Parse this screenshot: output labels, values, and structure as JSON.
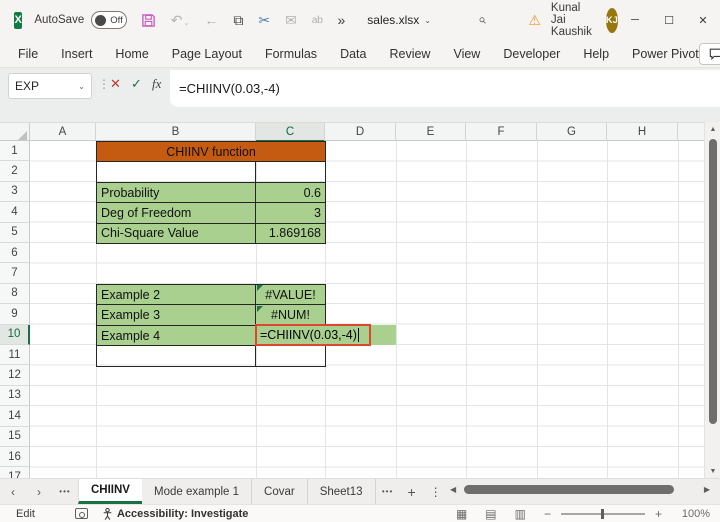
{
  "titlebar": {
    "app_initial": "X",
    "autosave_label": "AutoSave",
    "autosave_state": "Off",
    "doc_title": "sales.xlsx",
    "user_name": "Kunal Jai Kaushik",
    "user_initials": "KJ"
  },
  "icons": {
    "undo": "↶",
    "back": "←",
    "copy": "⧉",
    "cut": "✂",
    "mail": "✉",
    "replace": "ab",
    "overflow": "»",
    "chevron_down": "⌄",
    "warning": "⚠",
    "minimize": "─",
    "maximize": "☐",
    "close": "✕",
    "cancel": "✕",
    "enter": "✓",
    "dots_vertical": "⋮",
    "nav_left": "‹",
    "nav_right": "›",
    "tab_overflow": "•••",
    "add_sheet": "+",
    "scroll_up": "▲",
    "scroll_down": "▼",
    "scroll_left": "◀",
    "scroll_right": "▶",
    "view_normal": "▦",
    "view_layout": "▤",
    "view_break": "▥"
  },
  "ribbon": {
    "tabs": [
      "File",
      "Insert",
      "Home",
      "Page Layout",
      "Formulas",
      "Data",
      "Review",
      "View",
      "Developer",
      "Help",
      "Power Pivot"
    ],
    "comments_label": "Comments"
  },
  "formula_bar": {
    "name_box": "EXP",
    "fx_label": "fx",
    "formula": "=CHIINV(0.03,-4)"
  },
  "grid": {
    "col_headers": [
      "A",
      "B",
      "C",
      "D",
      "E",
      "F",
      "G",
      "H"
    ],
    "row_headers": [
      "1",
      "2",
      "3",
      "4",
      "5",
      "6",
      "7",
      "8",
      "9",
      "10",
      "11",
      "12",
      "13",
      "14",
      "15",
      "16",
      "17"
    ],
    "active_col": "C",
    "active_row": "10",
    "title_cell": "CHIINV function",
    "table1": [
      {
        "label": "Probability",
        "value": "0.6"
      },
      {
        "label": "Deg of Freedom",
        "value": "3"
      },
      {
        "label": "Chi-Square Value",
        "value": "1.869168"
      }
    ],
    "table2": [
      {
        "label": "Example 2",
        "value": "#VALUE!"
      },
      {
        "label": "Example 3",
        "value": "#NUM!"
      },
      {
        "label": "Example 4",
        "value": "=CHIINV(0.03,-4)"
      },
      {
        "label": "",
        "value": ""
      }
    ]
  },
  "sheet_tabs": {
    "tabs": [
      {
        "label": "CHIINV",
        "active": true
      },
      {
        "label": "Mode example 1",
        "active": false
      },
      {
        "label": "Covar",
        "active": false
      },
      {
        "label": "Sheet13",
        "active": false
      }
    ]
  },
  "status_bar": {
    "mode": "Edit",
    "accessibility": "Accessibility: Investigate",
    "zoom_out": "−",
    "zoom_in": "+",
    "zoom_level": "100%"
  },
  "colors": {
    "excel_green": "#107C41",
    "header_orange": "#C55A11",
    "cell_green": "#A9D08E",
    "edit_border_red": "#E0452E",
    "avatar_gold": "#97760B"
  }
}
